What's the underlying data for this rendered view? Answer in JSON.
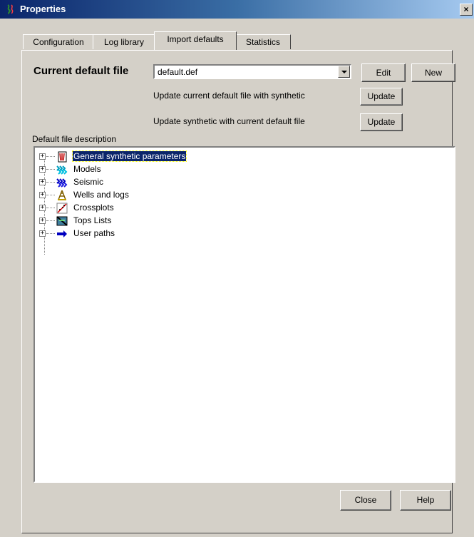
{
  "window": {
    "title": "Properties",
    "close_glyph": "×"
  },
  "tabs": [
    {
      "label": "Configuration"
    },
    {
      "label": "Log library"
    },
    {
      "label": "Import defaults"
    },
    {
      "label": "Statistics"
    }
  ],
  "active_tab": "Import defaults",
  "import": {
    "current_label": "Current default file",
    "current_value": "default.def",
    "edit_label": "Edit",
    "new_label": "New",
    "update_with_synthetic_label": "Update current default file with synthetic",
    "update_synthetic_label": "Update synthetic with current default file",
    "update_button_label": "Update",
    "description_label": "Default file description"
  },
  "tree": {
    "items": [
      {
        "label": "General synthetic parameters",
        "icon": "parameters-icon",
        "selected": true
      },
      {
        "label": "Models",
        "icon": "models-icon"
      },
      {
        "label": "Seismic",
        "icon": "seismic-icon"
      },
      {
        "label": "Wells and logs",
        "icon": "well-derrick-icon"
      },
      {
        "label": "Crossplots",
        "icon": "crossplot-icon"
      },
      {
        "label": "Tops Lists",
        "icon": "tops-icon"
      },
      {
        "label": "User paths",
        "icon": "arrow-right-icon"
      }
    ],
    "expand_glyph": "+"
  },
  "footer": {
    "close_label": "Close",
    "help_label": "Help"
  }
}
